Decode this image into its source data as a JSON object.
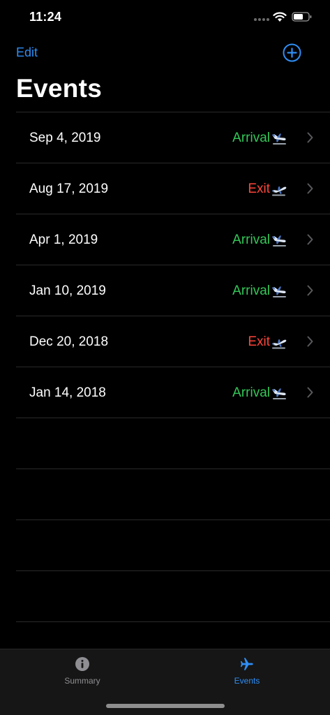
{
  "status_bar": {
    "time": "11:24"
  },
  "nav": {
    "edit_label": "Edit",
    "add_icon": "plus-circle-icon"
  },
  "page": {
    "title": "Events"
  },
  "colors": {
    "accent": "#2f8ef5",
    "arrival": "#34c759",
    "exit": "#ff453a",
    "tab_inactive": "#8e8e93"
  },
  "events": [
    {
      "date": "Sep 4, 2019",
      "type": "Arrival",
      "icon": "airplane-landing-icon"
    },
    {
      "date": "Aug 17, 2019",
      "type": "Exit",
      "icon": "airplane-takeoff-icon"
    },
    {
      "date": "Apr 1, 2019",
      "type": "Arrival",
      "icon": "airplane-landing-icon"
    },
    {
      "date": "Jan 10, 2019",
      "type": "Arrival",
      "icon": "airplane-landing-icon"
    },
    {
      "date": "Dec 20, 2018",
      "type": "Exit",
      "icon": "airplane-takeoff-icon"
    },
    {
      "date": "Jan 14, 2018",
      "type": "Arrival",
      "icon": "airplane-landing-icon"
    }
  ],
  "tab_bar": {
    "tabs": [
      {
        "label": "Summary",
        "icon": "info-circle-icon",
        "selected": false
      },
      {
        "label": "Events",
        "icon": "airplane-icon",
        "selected": true
      }
    ]
  }
}
